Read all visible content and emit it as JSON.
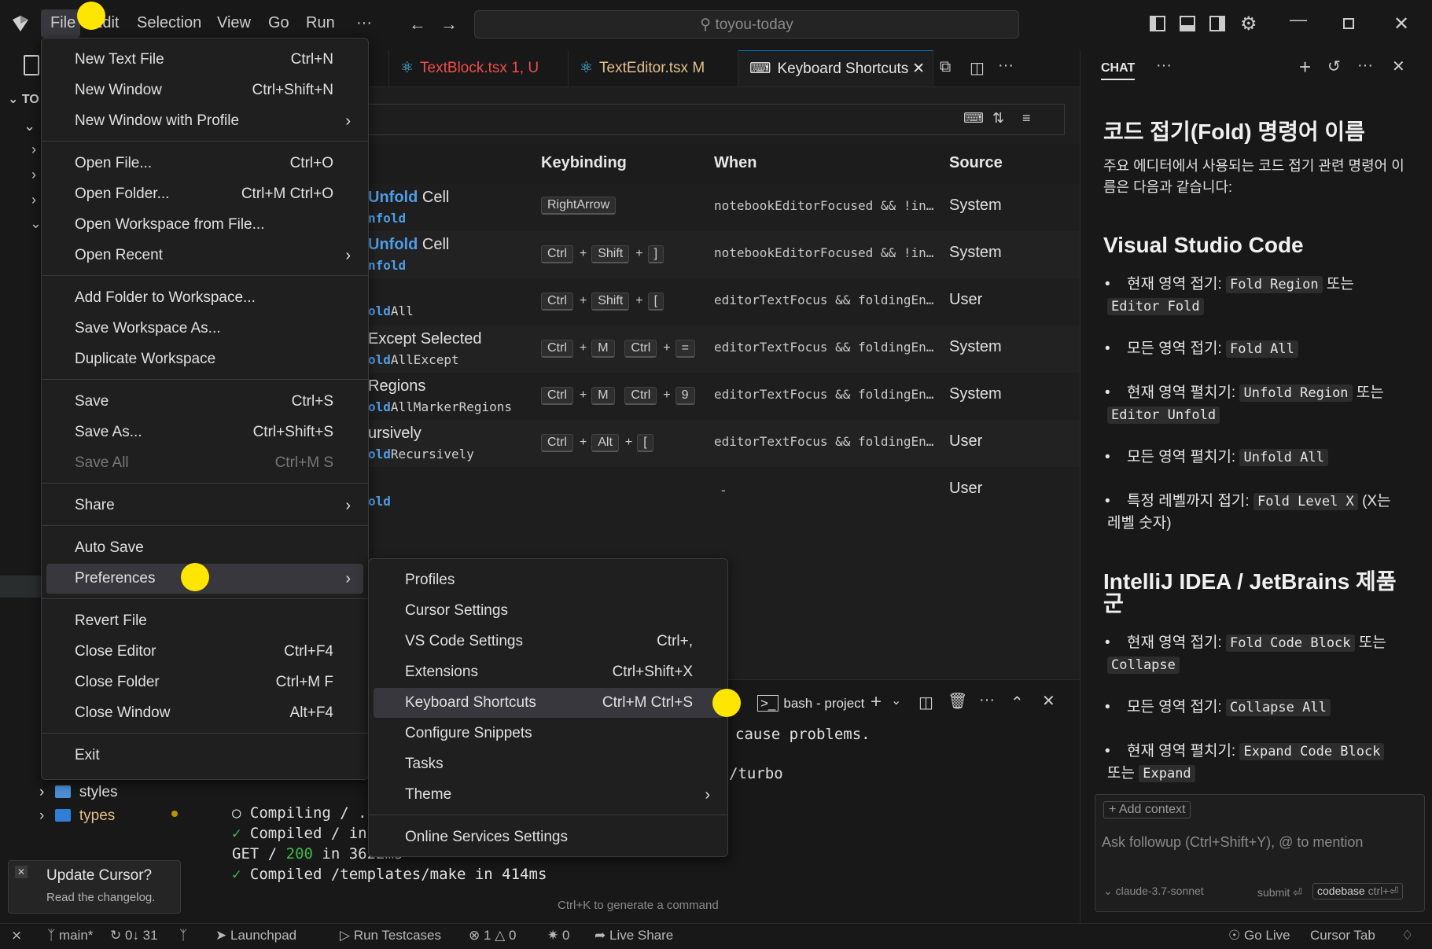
{
  "title_bar": {
    "menus": [
      "File",
      "Edit",
      "Selection",
      "View",
      "Go",
      "Run",
      "···"
    ],
    "search_text": "toyou-today"
  },
  "tabs": [
    {
      "label": "TextBlock.tsx",
      "badge": "1, U",
      "color": "#f14c4c"
    },
    {
      "label": "TextEditor.tsx",
      "badge": "M",
      "color": "#e2c08d"
    },
    {
      "label": "Keyboard Shortcuts",
      "badge": "",
      "color": "#e0e0e0"
    }
  ],
  "sidebar": {
    "section_label": "TO",
    "tree_items": [
      {
        "label": "styles",
        "color": "#e0e0e0"
      },
      {
        "label": "types",
        "color": "#e2c08d"
      }
    ],
    "notification": {
      "title": "Update Cursor?",
      "body": "Read the changelog."
    }
  },
  "keybindings": {
    "headers": {
      "keybinding": "Keybinding",
      "when": "When",
      "source": "Source"
    },
    "rows": [
      {
        "command": "Unfold Cell",
        "command_kw": "Unfold",
        "command_id": "nfold",
        "keys": [
          "RightArrow"
        ],
        "when": "notebookEditorFocused && !in…",
        "source": "System"
      },
      {
        "command": "Unfold Cell",
        "command_kw": "Unfold",
        "command_id": "nfold",
        "keys": [
          "Ctrl",
          "+",
          "Shift",
          "+",
          "]"
        ],
        "when": "notebookEditorFocused && !in…",
        "source": "System"
      },
      {
        "command": "",
        "command_kw": "",
        "command_id": "oldAll",
        "keys": [
          "Ctrl",
          "+",
          "Shift",
          "+",
          "["
        ],
        "when": "editorTextFocus && foldingEn…",
        "source": "User"
      },
      {
        "command": "Except Selected",
        "command_kw": "",
        "command_id": "oldAllExcept",
        "keys": [
          "Ctrl",
          "+",
          "M",
          "Ctrl",
          "+",
          "="
        ],
        "when": "editorTextFocus && foldingEn…",
        "source": "System"
      },
      {
        "command": "Regions",
        "command_kw": "",
        "command_id": "oldAllMarkerRegions",
        "keys": [
          "Ctrl",
          "+",
          "M",
          "Ctrl",
          "+",
          "9"
        ],
        "when": "editorTextFocus && foldingEn…",
        "source": "System"
      },
      {
        "command": "ursively",
        "command_kw": "",
        "command_id": "oldRecursively",
        "keys": [
          "Ctrl",
          "+",
          "Alt",
          "+",
          "["
        ],
        "when": "editorTextFocus && foldingEn…",
        "source": "User"
      },
      {
        "command": "",
        "command_kw": "",
        "command_id": "old",
        "keys": [],
        "when": "-",
        "source": "User"
      }
    ]
  },
  "terminal": {
    "tab_label": "bash - project",
    "lines": [
      "cause problems.",
      "/turbo",
      "○ Compiling / ..",
      "✓ Compiled / in",
      "GET / 200 in 3622ms",
      "✓ Compiled /templates/make in 414ms"
    ],
    "hint": "Ctrl+K to generate a command"
  },
  "file_menu": {
    "items": [
      {
        "label": "New Text File",
        "shortcut": "Ctrl+N"
      },
      {
        "label": "New Window",
        "shortcut": "Ctrl+Shift+N"
      },
      {
        "label": "New Window with Profile",
        "submenu": true
      },
      {
        "label": "Open File...",
        "shortcut": "Ctrl+O"
      },
      {
        "label": "Open Folder...",
        "shortcut": "Ctrl+M Ctrl+O"
      },
      {
        "label": "Open Workspace from File..."
      },
      {
        "label": "Open Recent",
        "submenu": true
      },
      {
        "label": "Add Folder to Workspace..."
      },
      {
        "label": "Save Workspace As..."
      },
      {
        "label": "Duplicate Workspace"
      },
      {
        "label": "Save",
        "shortcut": "Ctrl+S"
      },
      {
        "label": "Save As...",
        "shortcut": "Ctrl+Shift+S"
      },
      {
        "label": "Save All",
        "shortcut": "Ctrl+M S",
        "disabled": true
      },
      {
        "label": "Share",
        "submenu": true
      },
      {
        "label": "Auto Save"
      },
      {
        "label": "Preferences",
        "submenu": true,
        "highlighted": true
      },
      {
        "label": "Revert File"
      },
      {
        "label": "Close Editor",
        "shortcut": "Ctrl+F4"
      },
      {
        "label": "Close Folder",
        "shortcut": "Ctrl+M F"
      },
      {
        "label": "Close Window",
        "shortcut": "Alt+F4"
      },
      {
        "label": "Exit"
      }
    ]
  },
  "preferences_menu": {
    "items": [
      {
        "label": "Profiles"
      },
      {
        "label": "Cursor Settings"
      },
      {
        "label": "VS Code Settings",
        "shortcut": "Ctrl+,"
      },
      {
        "label": "Extensions",
        "shortcut": "Ctrl+Shift+X"
      },
      {
        "label": "Keyboard Shortcuts",
        "shortcut": "Ctrl+M Ctrl+S",
        "highlighted": true
      },
      {
        "label": "Configure Snippets"
      },
      {
        "label": "Tasks"
      },
      {
        "label": "Theme",
        "submenu": true
      },
      {
        "label": "Online Services Settings"
      }
    ]
  },
  "chat": {
    "header": "CHAT",
    "heading": "코드 접기(Fold) 명령어 이름",
    "intro": "주요 에디터에서 사용되는 코드 접기 관련 명령어 이름은 다음과 같습니다:",
    "vscode_heading": "Visual Studio Code",
    "intellij_heading": "IntelliJ IDEA / JetBrains 제품군",
    "or": "또는",
    "vscode_items": [
      {
        "label": "현재 영역 접기:",
        "code1": "Fold Region",
        "code2": "Editor Fold",
        "suffix": ""
      },
      {
        "label": "모든 영역 접기:",
        "code1": "Fold All",
        "code2": "",
        "suffix": ""
      },
      {
        "label": "현재 영역 펼치기:",
        "code1": "Unfold Region",
        "code2": "Editor Unfold",
        "suffix": ""
      },
      {
        "label": "모든 영역 펼치기:",
        "code1": "Unfold All",
        "code2": "",
        "suffix": ""
      },
      {
        "label": "특정 레벨까지 접기:",
        "code1": "Fold Level X",
        "code2": "",
        "suffix": "(X는 레벨 숫자)"
      }
    ],
    "intellij_items": [
      {
        "label": "현재 영역 접기:",
        "code1": "Fold Code Block",
        "code2": "Collapse"
      },
      {
        "label": "모든 영역 접기:",
        "code1": "Collapse All",
        "code2": ""
      },
      {
        "label": "현재 영역 펼치기:",
        "code1": "Expand Code Block",
        "code2": "Expand"
      }
    ],
    "add_context": "+ Add context",
    "input_placeholder": "Ask followup (Ctrl+Shift+Y), @ to mention",
    "model": "claude-3.7-sonnet",
    "submit": "submit",
    "codebase": "codebase",
    "codebase_shortcut": "ctrl+⏎"
  },
  "status_bar": {
    "branch": "main*",
    "sync": "0↓ 31",
    "launchpad": "Launchpad",
    "run_testcases": "Run Testcases",
    "errors": "1",
    "warnings": "0",
    "ports": "0",
    "live_share": "Live Share",
    "go_live": "Go Live",
    "cursor_tab": "Cursor Tab"
  }
}
